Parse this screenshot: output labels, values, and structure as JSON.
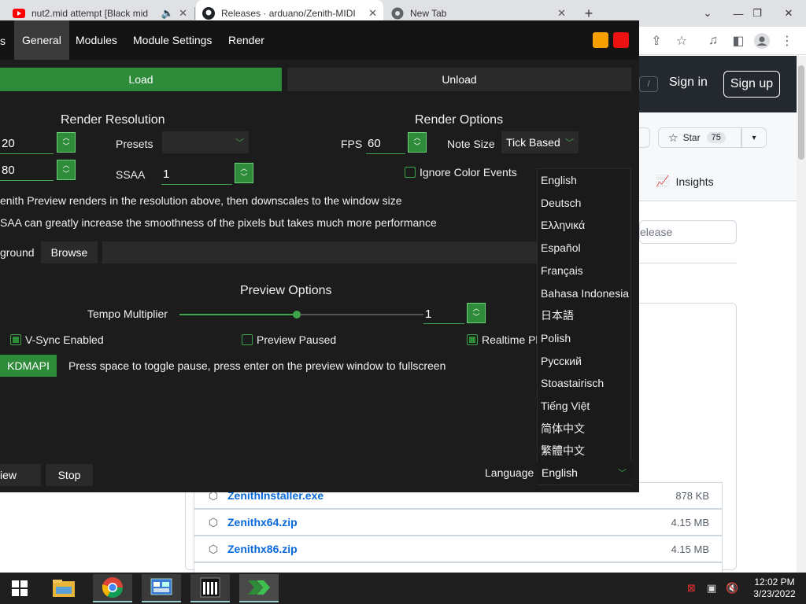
{
  "browser": {
    "tabs": [
      {
        "title": "nut2.mid attempt [Black mid",
        "active": false
      },
      {
        "title": "Releases · arduano/Zenith-MIDI",
        "active": true
      },
      {
        "title": "New Tab",
        "active": false
      }
    ],
    "new_tab_label": "+"
  },
  "github": {
    "sign_in": "Sign in",
    "sign_up": "Sign up",
    "slash_key": "/",
    "star_label": "Star",
    "star_count": "75",
    "insights_label": "Insights",
    "filter_placeholder": "elease",
    "assets": [
      {
        "name": "ZenithInstaller.exe",
        "size": "878 KB"
      },
      {
        "name": "Zenithx64.zip",
        "size": "4.15 MB"
      },
      {
        "name": "Zenithx86.zip",
        "size": "4.15 MB"
      }
    ]
  },
  "zenith": {
    "tabs": [
      {
        "label": "General",
        "active": true
      },
      {
        "label": "Modules",
        "active": false
      },
      {
        "label": "Module Settings",
        "active": false
      },
      {
        "label": "Render",
        "active": false
      }
    ],
    "colors": {
      "swatch_1": "#f5a000",
      "swatch_2": "#ee1111",
      "accent": "#2e8b3a"
    },
    "load_label": "Load",
    "unload_label": "Unload",
    "render_resolution_heading": "Render Resolution",
    "render_options_heading": "Render Options",
    "width_value": "20",
    "height_value": "80",
    "presets_label": "Presets",
    "presets_value": "",
    "ssaa_label": "SSAA",
    "ssaa_value": "1",
    "fps_label": "FPS",
    "fps_value": "60",
    "note_size_label": "Note Size",
    "note_size_value": "Tick Based",
    "ignore_color_events_label": "Ignore Color Events",
    "info_line_1": "enith Preview renders in the resolution above, then downscales to the window size",
    "info_line_2": "SAA can greatly increase the smoothness of the pixels but takes much more performance",
    "background_label": "ground",
    "browse_label": "Browse",
    "background_path": "",
    "preview_options_heading": "Preview Options",
    "tempo_multiplier_label": "Tempo Multiplier",
    "tempo_multiplier_value": "1",
    "tempo_slider_fraction": 0.48,
    "vsync_label": "V-Sync Enabled",
    "vsync_checked": true,
    "preview_paused_label": "Preview Paused",
    "preview_paused_checked": false,
    "realtime_label": "Realtime Pla",
    "realtime_checked": true,
    "kdmapi_label": "KDMAPI",
    "hint_text": "Press space to toggle pause, press enter on the preview window to fullscreen",
    "preview_label": "iew",
    "stop_label": "Stop",
    "language_label": "Language",
    "language_value": "English",
    "language_options": [
      "English",
      "Deutsch",
      "Ελληνικά",
      "Español",
      "Français",
      "Bahasa Indonesia",
      "日本語",
      "Polish",
      "Русский",
      "Stoastairisch",
      "Tiếng Việt",
      "简体中文",
      "繁體中文"
    ]
  },
  "taskbar": {
    "time": "12:02 PM",
    "date": "3/23/2022"
  }
}
